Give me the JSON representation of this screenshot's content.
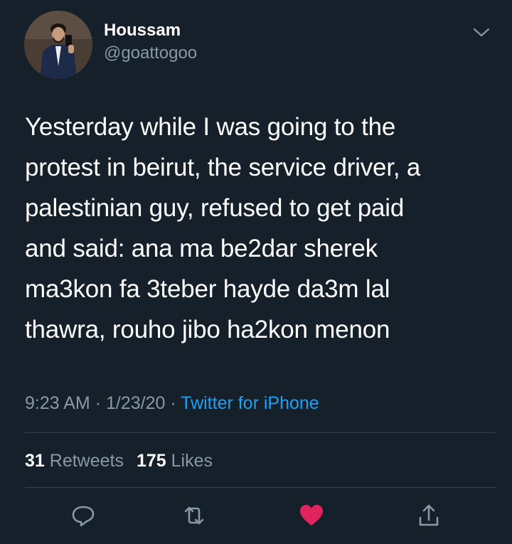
{
  "user": {
    "display_name": "Houssam",
    "handle": "@goattogoo"
  },
  "tweet": {
    "lines": [
      "Yesterday while I was going to the",
      "protest in beirut, the service driver, a",
      "palestinian guy, refused to get paid",
      "and said: ana ma be2dar sherek",
      "ma3kon fa 3teber hayde da3m lal",
      "thawra, rouho jibo ha2kon menon"
    ],
    "time": "9:23 AM",
    "date": "1/23/20",
    "separator": "·",
    "source": "Twitter for iPhone"
  },
  "stats": {
    "retweets_count": "31",
    "retweets_label": "Retweets",
    "likes_count": "175",
    "likes_label": "Likes"
  },
  "actions": {
    "reply_icon": "reply-icon",
    "retweet_icon": "retweet-icon",
    "like_icon": "heart-icon",
    "share_icon": "share-icon",
    "liked": true
  },
  "colors": {
    "background": "#15202b",
    "text": "#ffffff",
    "secondary_text": "#8899a6",
    "link": "#1da1f2",
    "like": "#e0245e",
    "divider": "#38444d"
  }
}
